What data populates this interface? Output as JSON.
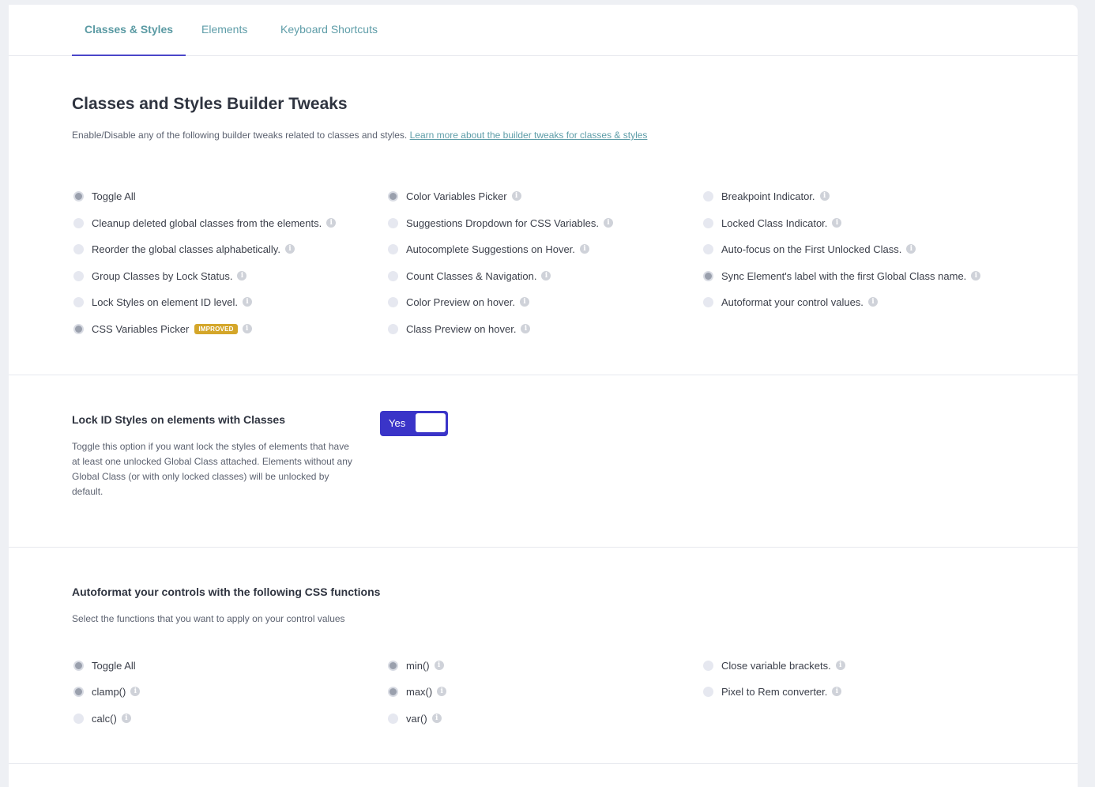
{
  "tabs": [
    {
      "label": "Classes & Styles",
      "active": true
    },
    {
      "label": "Elements",
      "active": false
    },
    {
      "label": "Keyboard Shortcuts",
      "active": false
    }
  ],
  "tweaks": {
    "title": "Classes and Styles Builder Tweaks",
    "description": "Enable/Disable any of the following builder tweaks related to classes and styles.",
    "link_text": "Learn more about the builder tweaks for classes & styles",
    "options": [
      {
        "label": "Toggle All",
        "checked": true
      },
      {
        "label": "Cleanup deleted global classes from the elements.",
        "checked": false
      },
      {
        "label": "Reorder the global classes alphabetically.",
        "checked": false
      },
      {
        "label": "Group Classes by Lock Status.",
        "checked": false
      },
      {
        "label": "Lock Styles on element ID level.",
        "checked": false
      },
      {
        "label": "CSS Variables Picker",
        "checked": true,
        "badge": "IMPROVED"
      },
      {
        "label": "Color Variables Picker",
        "checked": true
      },
      {
        "label": "Suggestions Dropdown for CSS Variables.",
        "checked": false
      },
      {
        "label": "Autocomplete Suggestions on Hover.",
        "checked": false
      },
      {
        "label": "Count Classes & Navigation.",
        "checked": false
      },
      {
        "label": "Color Preview on hover.",
        "checked": false
      },
      {
        "label": "Class Preview on hover.",
        "checked": false
      },
      {
        "label": "Breakpoint Indicator.",
        "checked": false
      },
      {
        "label": "Locked Class Indicator.",
        "checked": false
      },
      {
        "label": "Auto-focus on the First Unlocked Class.",
        "checked": false
      },
      {
        "label": "Sync Element's label with the first Global Class name.",
        "checked": true
      },
      {
        "label": "Autoformat your control values.",
        "checked": false
      }
    ]
  },
  "lock_id": {
    "title": "Lock ID Styles on elements with Classes",
    "description": "Toggle this option if you want lock the styles of elements that have at least one unlocked Global Class attached. Elements without any Global Class (or with only locked classes) will be unlocked by default.",
    "toggle_label": "Yes"
  },
  "autoformat": {
    "title": "Autoformat your controls with the following CSS functions",
    "description": "Select the functions that you want to apply on your control values",
    "options": [
      {
        "label": "Toggle All",
        "checked": true
      },
      {
        "label": "clamp()",
        "checked": true
      },
      {
        "label": "calc()",
        "checked": false
      },
      {
        "label": "min()",
        "checked": true
      },
      {
        "label": "max()",
        "checked": true
      },
      {
        "label": "var()",
        "checked": false
      },
      {
        "label": "Close variable brackets.",
        "checked": false
      },
      {
        "label": "Pixel to Rem converter.",
        "checked": false
      }
    ]
  },
  "icons": {
    "info": "info-icon",
    "radio": "radio-dot"
  }
}
